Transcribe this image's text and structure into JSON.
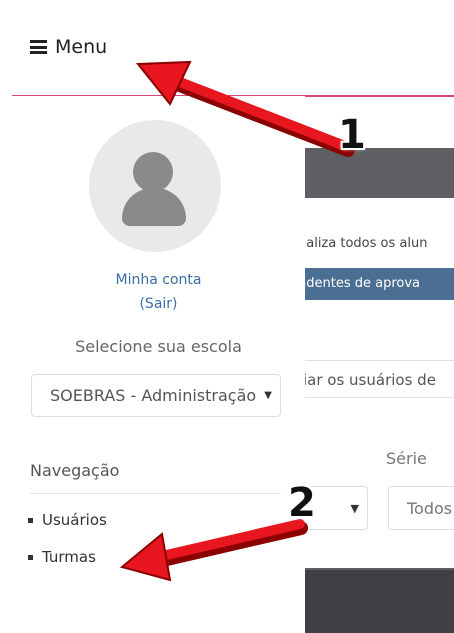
{
  "topbar": {
    "menu_label": "Menu"
  },
  "sidebar": {
    "account_link": "Minha conta",
    "logout_link": "(Sair)",
    "school_label": "Selecione sua escola",
    "school_selected": "SOEBRAS - Administração",
    "nav_title": "Navegação",
    "items": [
      {
        "label": "Usuários"
      },
      {
        "label": "Turmas"
      }
    ]
  },
  "background": {
    "help_text": "ualiza todos os alun",
    "pending_label": "ndentes de aprova",
    "manage_text": "iar os usuários de",
    "serie_label": "Série",
    "todos_value": "Todos"
  },
  "annotations": {
    "step1": "1",
    "step2": "2",
    "arrow_color": "#e8161e"
  },
  "colors": {
    "accent_line": "#d9457a",
    "link": "#3a6ea5",
    "pending_bar": "#4b6f93",
    "overlay": "#5d5f63"
  }
}
